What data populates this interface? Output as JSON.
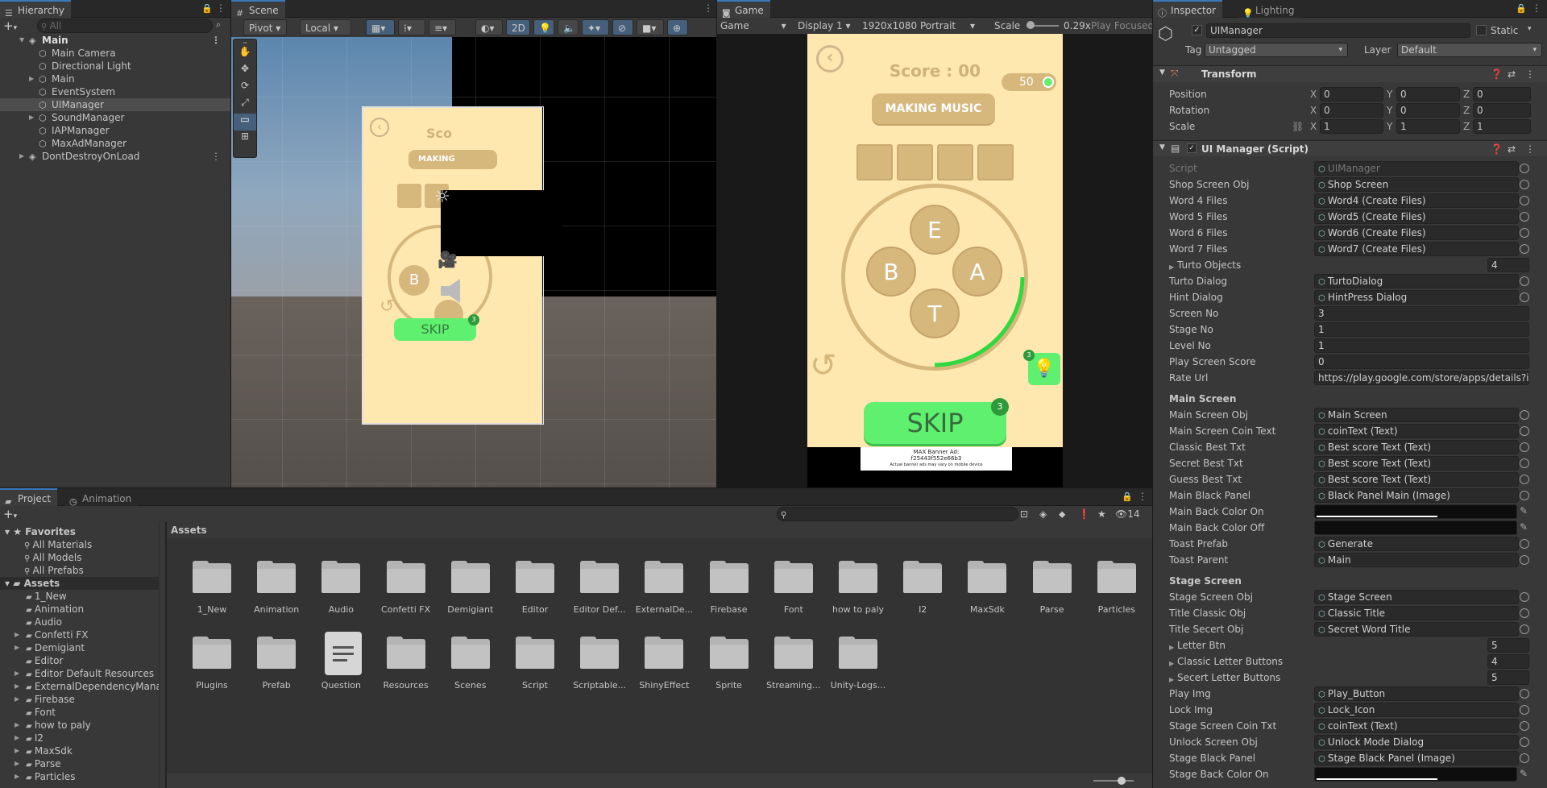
{
  "hierarchy": {
    "tab": "Hierarchy",
    "search_placeholder": "All",
    "items": [
      {
        "label": "Main",
        "level": 0,
        "bold": true,
        "arrow": "▼",
        "icon": "unity-scene-icon"
      },
      {
        "label": "Main Camera",
        "level": 1
      },
      {
        "label": "Directional Light",
        "level": 1
      },
      {
        "label": "Main",
        "level": 1,
        "arrow": "▶"
      },
      {
        "label": "EventSystem",
        "level": 1
      },
      {
        "label": "UIManager",
        "level": 1,
        "selected": true
      },
      {
        "label": "SoundManager",
        "level": 1,
        "arrow": "▶"
      },
      {
        "label": "IAPManager",
        "level": 1
      },
      {
        "label": "MaxAdManager",
        "level": 1
      },
      {
        "label": "DontDestroyOnLoad",
        "level": 0,
        "arrow": "▶",
        "icon": "unity-scene-icon"
      }
    ]
  },
  "scene": {
    "tab": "Scene",
    "pivot": "Pivot",
    "local": "Local",
    "mode_2d": "2D",
    "canvas": {
      "score": "Sco",
      "making": "MAKING",
      "skip": "SKIP",
      "badge": "3",
      "letter_b": "B"
    }
  },
  "game": {
    "tab": "Game",
    "game_label": "Game",
    "display": "Display 1",
    "resolution": "1920x1080 Portrait",
    "scale_label": "Scale",
    "scale_value": "0.29x",
    "play_focused": "Play Focused",
    "score": "Score : 00",
    "coins": "50",
    "making": "MAKING MUSIC",
    "letters": [
      "E",
      "B",
      "A",
      "T"
    ],
    "skip": "SKIP",
    "skip_badge": "3",
    "hint_badge": "3",
    "ad_title": "MAX Banner Ad:",
    "ad_id": "f25443f552e66b3",
    "ad_small": "Actual banner ads may vary on mobile device"
  },
  "inspector": {
    "tab": "Inspector",
    "lighting_tab": "Lighting",
    "object_name": "UIManager",
    "static_label": "Static",
    "tag_label": "Tag",
    "tag_value": "Untagged",
    "layer_label": "Layer",
    "layer_value": "Default",
    "transform": {
      "title": "Transform",
      "rows": [
        {
          "label": "Position",
          "x": "0",
          "y": "0",
          "z": "0"
        },
        {
          "label": "Rotation",
          "x": "0",
          "y": "0",
          "z": "0"
        },
        {
          "label": "Scale",
          "x": "1",
          "y": "1",
          "z": "1"
        }
      ]
    },
    "script_title": "UI Manager (Script)",
    "fields": [
      {
        "label": "Script",
        "value": "UIManager",
        "kind": "disabled"
      },
      {
        "label": "Shop Screen Obj",
        "value": "Shop Screen",
        "kind": "ref"
      },
      {
        "label": "Word 4 Files",
        "value": "Word4 (Create Files)",
        "kind": "ref"
      },
      {
        "label": "Word 5 Files",
        "value": "Word5 (Create Files)",
        "kind": "ref"
      },
      {
        "label": "Word 6 Files",
        "value": "Word6 (Create Files)",
        "kind": "ref"
      },
      {
        "label": "Word 7 Files",
        "value": "Word7 (Create Files)",
        "kind": "ref"
      },
      {
        "label": "Turto Objects",
        "value": "4",
        "kind": "array"
      },
      {
        "label": "Turto Dialog",
        "value": "TurtoDialog",
        "kind": "ref"
      },
      {
        "label": "Hint Dialog",
        "value": "HintPress Dialog",
        "kind": "ref"
      },
      {
        "label": "Screen No",
        "value": "3",
        "kind": "num"
      },
      {
        "label": "Stage No",
        "value": "1",
        "kind": "num"
      },
      {
        "label": "Level No",
        "value": "1",
        "kind": "num"
      },
      {
        "label": "Play Screen Score",
        "value": "0",
        "kind": "num"
      },
      {
        "label": "Rate Url",
        "value": "https://play.google.com/store/apps/details?id=",
        "kind": "num"
      },
      {
        "label": "Main Screen",
        "kind": "header"
      },
      {
        "label": "Main Screen Obj",
        "value": "Main Screen",
        "kind": "ref"
      },
      {
        "label": "Main Screen Coin Text",
        "value": "coinText (Text)",
        "kind": "ref"
      },
      {
        "label": "Classic Best Txt",
        "value": "Best score Text (Text)",
        "kind": "ref"
      },
      {
        "label": "Secret Best Txt",
        "value": "Best score Text (Text)",
        "kind": "ref"
      },
      {
        "label": "Guess Best Txt",
        "value": "Best score Text (Text)",
        "kind": "ref"
      },
      {
        "label": "Main Black Panel",
        "value": "Black Panel Main (Image)",
        "kind": "ref"
      },
      {
        "label": "Main Back Color On",
        "value": "",
        "kind": "color"
      },
      {
        "label": "Main Back Color Off",
        "value": "",
        "kind": "color"
      },
      {
        "label": "Toast Prefab",
        "value": "Generate",
        "kind": "ref"
      },
      {
        "label": "Toast Parent",
        "value": "Main",
        "kind": "ref"
      },
      {
        "label": "Stage Screen",
        "kind": "header"
      },
      {
        "label": "Stage Screen Obj",
        "value": "Stage Screen",
        "kind": "ref"
      },
      {
        "label": "Title Classic Obj",
        "value": "Classic Title",
        "kind": "ref"
      },
      {
        "label": "Title Secert Obj",
        "value": "Secret Word Title",
        "kind": "ref"
      },
      {
        "label": "Letter Btn",
        "value": "5",
        "kind": "array"
      },
      {
        "label": "Classic Letter Buttons",
        "value": "4",
        "kind": "array"
      },
      {
        "label": "Secert Letter Buttons",
        "value": "5",
        "kind": "array"
      },
      {
        "label": "Play Img",
        "value": "Play_Button",
        "kind": "ref"
      },
      {
        "label": "Lock Img",
        "value": "Lock_Icon",
        "kind": "ref"
      },
      {
        "label": "Stage Screen Coin Txt",
        "value": "coinText (Text)",
        "kind": "ref"
      },
      {
        "label": "Unlock Screen Obj",
        "value": "Unlock Mode Dialog",
        "kind": "ref"
      },
      {
        "label": "Stage Black Panel",
        "value": "Stage Black Panel (Image)",
        "kind": "ref"
      },
      {
        "label": "Stage Back Color On",
        "value": "",
        "kind": "color"
      }
    ]
  },
  "project": {
    "tab": "Project",
    "animation_tab": "Animation",
    "hidden_count": "14",
    "breadcrumb": "Assets",
    "favorites": {
      "label": "Favorites",
      "items": [
        "All Materials",
        "All Models",
        "All Prefabs"
      ]
    },
    "tree_root": "Assets",
    "tree": [
      "1_New",
      "Animation",
      "Audio",
      "Confetti FX",
      "Demigiant",
      "Editor",
      "Editor Default Resources",
      "ExternalDependencyMana",
      "Firebase",
      "Font",
      "how to paly",
      "I2",
      "MaxSdk",
      "Parse",
      "Particles"
    ],
    "tree_arrows": [
      false,
      false,
      false,
      true,
      true,
      false,
      true,
      true,
      true,
      false,
      true,
      true,
      true,
      true,
      true
    ],
    "assets": [
      {
        "label": "1_New",
        "type": "folder"
      },
      {
        "label": "Animation",
        "type": "folder"
      },
      {
        "label": "Audio",
        "type": "folder"
      },
      {
        "label": "Confetti FX",
        "type": "folder"
      },
      {
        "label": "Demigiant",
        "type": "folder"
      },
      {
        "label": "Editor",
        "type": "folder"
      },
      {
        "label": "Editor Def...",
        "type": "folder"
      },
      {
        "label": "ExternalDe...",
        "type": "folder"
      },
      {
        "label": "Firebase",
        "type": "folder"
      },
      {
        "label": "Font",
        "type": "folder"
      },
      {
        "label": "how to paly",
        "type": "folder"
      },
      {
        "label": "I2",
        "type": "folder"
      },
      {
        "label": "MaxSdk",
        "type": "folder"
      },
      {
        "label": "Parse",
        "type": "folder"
      },
      {
        "label": "Particles",
        "type": "folder"
      },
      {
        "label": "Plugins",
        "type": "folder"
      },
      {
        "label": "Prefab",
        "type": "folder"
      },
      {
        "label": "Question",
        "type": "file"
      },
      {
        "label": "Resources",
        "type": "folder"
      },
      {
        "label": "Scenes",
        "type": "folder"
      },
      {
        "label": "Script",
        "type": "folder"
      },
      {
        "label": "Scriptable...",
        "type": "folder"
      },
      {
        "label": "ShinyEffect",
        "type": "folder"
      },
      {
        "label": "Sprite",
        "type": "folder"
      },
      {
        "label": "Streaming...",
        "type": "folder"
      },
      {
        "label": "Unity-Logs...",
        "type": "folder"
      }
    ]
  },
  "colors": {
    "accent": "#3a79bb",
    "selected_row": "#46607c",
    "cream": "#ffe7b0",
    "tan": "#d6b77c",
    "green": "#5ef06e"
  }
}
